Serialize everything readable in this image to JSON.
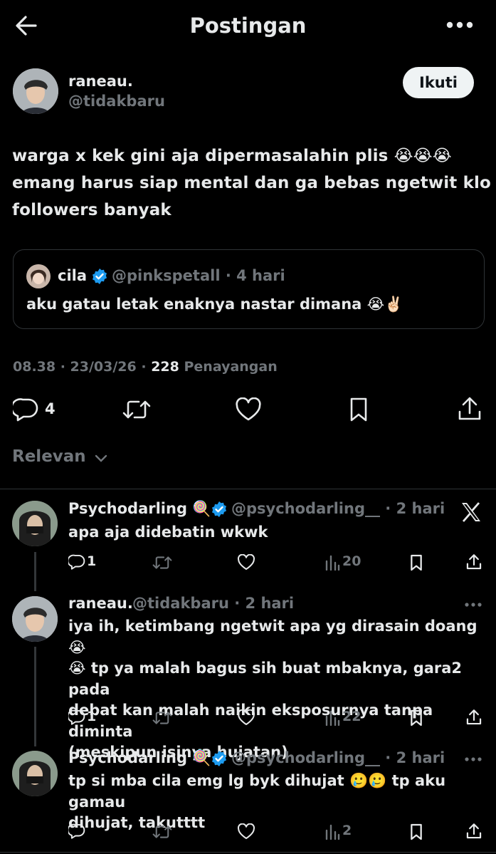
{
  "header": {
    "title": "Postingan"
  },
  "post": {
    "author_name": "raneau.",
    "author_handle": "@tidakbaru",
    "follow_label": "Ikuti",
    "text_line1": "warga x kek gini aja dipermasalahin plis 😭😭😭",
    "text_line2": "emang harus siap mental dan ga bebas ngetwit klo",
    "text_line3": "followers banyak",
    "quote": {
      "name": "cila",
      "handle_time": "@pinkspetall · 4 hari",
      "text": "aku gatau letak enaknya nastar dimana 😭✌🏻"
    },
    "meta_time": "08.38 · 23/03/26 · ",
    "views_count": "228",
    "views_label": " Penayangan",
    "reply_count": "4"
  },
  "sort": {
    "label": "Relevan"
  },
  "replies": [
    {
      "name": "Psychodarling 🍭",
      "handle_time": "@psychodarling__ · 2 hari",
      "lines": [
        "apa aja didebatin wkwk"
      ],
      "reply_count": "1",
      "views": "20"
    },
    {
      "name": "raneau.",
      "handle_time": "@tidakbaru · 2 hari",
      "lines": [
        "iya ih, ketimbang ngetwit apa yg dirasain doang 😭",
        "😭 tp ya malah bagus sih buat mbaknya, gara2 pada",
        "debat kan malah naikin eksposurnya tanpa diminta",
        "(meskipun isinya hujatan)"
      ],
      "reply_count": "1",
      "views": "22"
    },
    {
      "name": "Psychodarling 🍭",
      "handle_time": "@psychodarling__ · 2 hari",
      "lines": [
        "tp si mba cila emg lg byk dihujat 🥲🥲 tp aku gamau",
        "dihujat, takutttt"
      ],
      "reply_count": "",
      "views": "2"
    }
  ],
  "colors": {
    "accent": "#1d9bf0",
    "muted": "#71767b",
    "text": "#e7e9ea",
    "divider": "#2f3336"
  }
}
